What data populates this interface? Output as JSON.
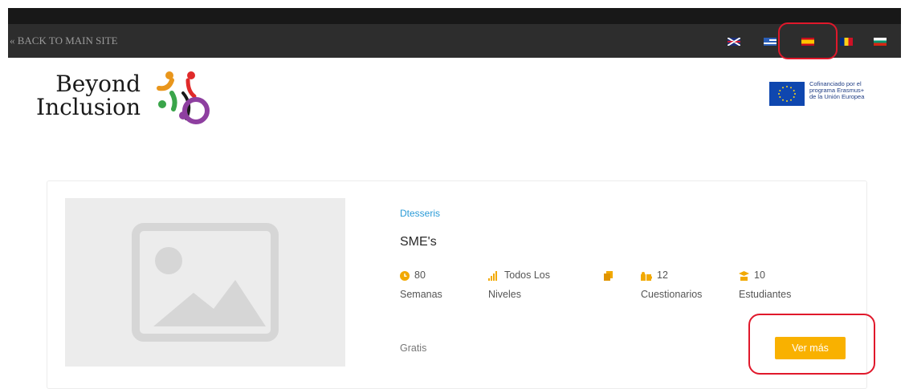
{
  "topbar": {
    "back_link": "« BACK TO MAIN SITE",
    "languages": [
      "English",
      "Greek",
      "Spanish",
      "Romanian",
      "Bulgarian"
    ],
    "highlighted_language": "Spanish"
  },
  "logo": {
    "text_line1": "Beyond",
    "text_line2": "Inclusion"
  },
  "eu_badge": {
    "line1": "Cofinanciado por el",
    "line2": "programa Erasmus+",
    "line3": "de la Unión Europea"
  },
  "course": {
    "author": "Dtesseris",
    "title": "SME's",
    "stats": [
      {
        "value": "80",
        "label": "Semanas",
        "icon": "clock-icon"
      },
      {
        "value": "Todos Los",
        "label": "Niveles",
        "icon": "signal-bars-icon"
      },
      {
        "value": "",
        "label": "",
        "icon": "files-icon"
      },
      {
        "value": "12",
        "label": "Cuestionarios",
        "icon": "puzzle-icon"
      },
      {
        "value": "10",
        "label": "Estudiantes",
        "icon": "graduate-icon"
      }
    ],
    "price": "Gratis",
    "button_label": "Ver más"
  },
  "colors": {
    "accent": "#f9b100",
    "author_link": "#2a9bd7",
    "topbar": "#2d2d2d",
    "highlight": "#e0182b"
  }
}
